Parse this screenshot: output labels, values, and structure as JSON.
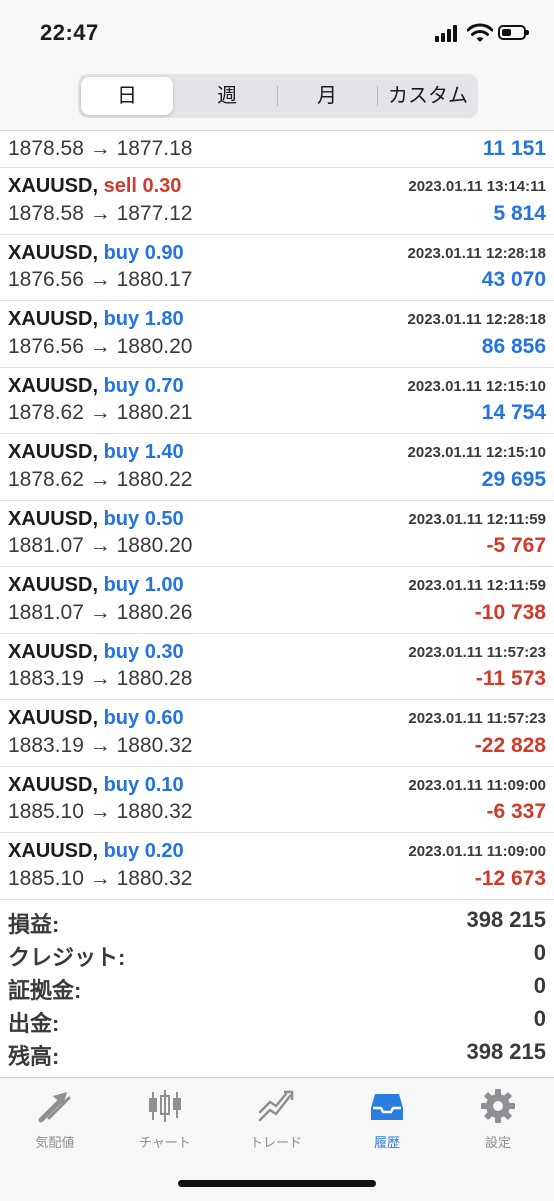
{
  "status": {
    "time": "22:47"
  },
  "segments": [
    "日",
    "週",
    "月",
    "カスタム"
  ],
  "partial_row": {
    "price": "1878.58 → 1877.18",
    "profit": "11 151",
    "profit_sign": "pos"
  },
  "trades": [
    {
      "symbol": "XAUUSD,",
      "side": "sell 0.30",
      "side_type": "sell",
      "date": "2023.01.11 13:14:11",
      "price": "1878.58 → 1877.12",
      "profit": "5 814",
      "profit_sign": "pos"
    },
    {
      "symbol": "XAUUSD,",
      "side": "buy 0.90",
      "side_type": "buy",
      "date": "2023.01.11 12:28:18",
      "price": "1876.56 → 1880.17",
      "profit": "43 070",
      "profit_sign": "pos"
    },
    {
      "symbol": "XAUUSD,",
      "side": "buy 1.80",
      "side_type": "buy",
      "date": "2023.01.11 12:28:18",
      "price": "1876.56 → 1880.20",
      "profit": "86 856",
      "profit_sign": "pos"
    },
    {
      "symbol": "XAUUSD,",
      "side": "buy 0.70",
      "side_type": "buy",
      "date": "2023.01.11 12:15:10",
      "price": "1878.62 → 1880.21",
      "profit": "14 754",
      "profit_sign": "pos"
    },
    {
      "symbol": "XAUUSD,",
      "side": "buy 1.40",
      "side_type": "buy",
      "date": "2023.01.11 12:15:10",
      "price": "1878.62 → 1880.22",
      "profit": "29 695",
      "profit_sign": "pos"
    },
    {
      "symbol": "XAUUSD,",
      "side": "buy 0.50",
      "side_type": "buy",
      "date": "2023.01.11 12:11:59",
      "price": "1881.07 → 1880.20",
      "profit": "-5 767",
      "profit_sign": "neg"
    },
    {
      "symbol": "XAUUSD,",
      "side": "buy 1.00",
      "side_type": "buy",
      "date": "2023.01.11 12:11:59",
      "price": "1881.07 → 1880.26",
      "profit": "-10 738",
      "profit_sign": "neg"
    },
    {
      "symbol": "XAUUSD,",
      "side": "buy 0.30",
      "side_type": "buy",
      "date": "2023.01.11 11:57:23",
      "price": "1883.19 → 1880.28",
      "profit": "-11 573",
      "profit_sign": "neg"
    },
    {
      "symbol": "XAUUSD,",
      "side": "buy 0.60",
      "side_type": "buy",
      "date": "2023.01.11 11:57:23",
      "price": "1883.19 → 1880.32",
      "profit": "-22 828",
      "profit_sign": "neg"
    },
    {
      "symbol": "XAUUSD,",
      "side": "buy 0.10",
      "side_type": "buy",
      "date": "2023.01.11 11:09:00",
      "price": "1885.10 → 1880.32",
      "profit": "-6 337",
      "profit_sign": "neg"
    },
    {
      "symbol": "XAUUSD,",
      "side": "buy 0.20",
      "side_type": "buy",
      "date": "2023.01.11 11:09:00",
      "price": "1885.10 → 1880.32",
      "profit": "-12 673",
      "profit_sign": "neg"
    }
  ],
  "summary": [
    {
      "label": "損益:",
      "value": "398 215"
    },
    {
      "label": "クレジット:",
      "value": "0"
    },
    {
      "label": "証拠金:",
      "value": "0"
    },
    {
      "label": "出金:",
      "value": "0"
    },
    {
      "label": "残高:",
      "value": "398 215"
    }
  ],
  "tabs": [
    {
      "label": "気配値",
      "icon": "quotes-arrows-icon"
    },
    {
      "label": "チャート",
      "icon": "candlestick-chart-icon"
    },
    {
      "label": "トレード",
      "icon": "trade-chart-icon"
    },
    {
      "label": "履歴",
      "icon": "history-inbox-icon",
      "active": true
    },
    {
      "label": "設定",
      "icon": "gear-icon"
    }
  ],
  "colors": {
    "profit_positive": "#2474e0",
    "profit_negative": "#d03a2a",
    "active_tab": "#2a7de1"
  }
}
